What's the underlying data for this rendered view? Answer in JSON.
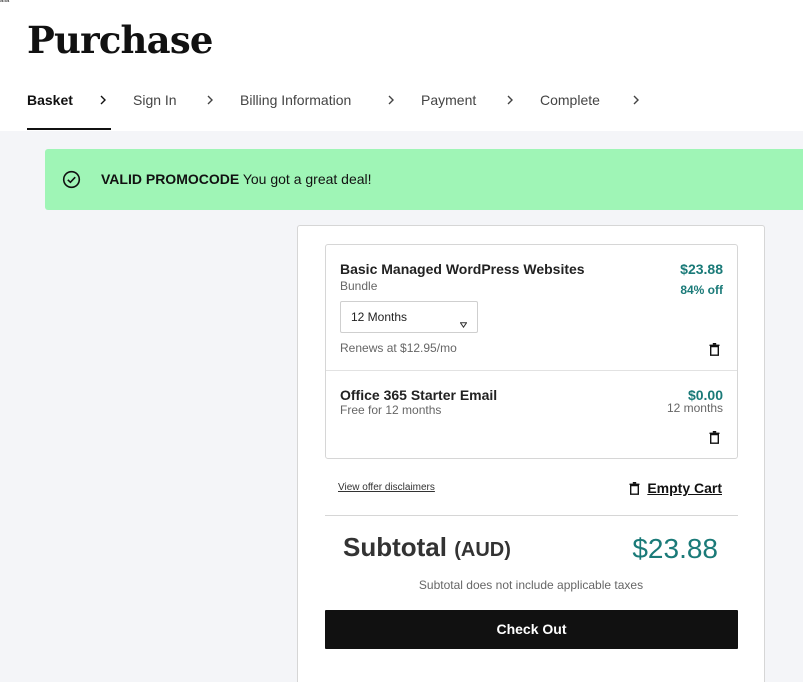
{
  "corner_label": "alia",
  "page": {
    "title": "Purchase"
  },
  "steps": [
    {
      "label": "Basket",
      "active": true
    },
    {
      "label": "Sign In",
      "active": false
    },
    {
      "label": "Billing Information",
      "active": false
    },
    {
      "label": "Payment",
      "active": false
    },
    {
      "label": "Complete",
      "active": false
    }
  ],
  "promo": {
    "strong": "VALID PROMOCODE",
    "text": " You got a great deal!"
  },
  "items": [
    {
      "name": "Basic Managed WordPress Websites",
      "subtitle": "Bundle",
      "price": "$23.88",
      "discount": "84% off",
      "term": "12 Months",
      "renews": "Renews at $12.95/mo"
    },
    {
      "name": "Office 365 Starter Email",
      "subtitle": "Free for 12 months",
      "price": "$0.00",
      "term": "12 months"
    }
  ],
  "links": {
    "disclaimers": "View offer disclaimers",
    "empty_cart": "Empty Cart"
  },
  "summary": {
    "label": "Subtotal",
    "currency": "(AUD)",
    "value": "$23.88",
    "tax_note": "Subtotal does not include applicable taxes"
  },
  "checkout_label": "Check Out",
  "colors": {
    "accent": "#1a7a78",
    "promo_bg": "#9ff5b6",
    "checkout_bg": "#111111"
  },
  "icons": {
    "chevron": "chevron-right-icon",
    "check": "check-circle-icon",
    "trash": "trash-icon",
    "caret": "caret-down-icon"
  }
}
